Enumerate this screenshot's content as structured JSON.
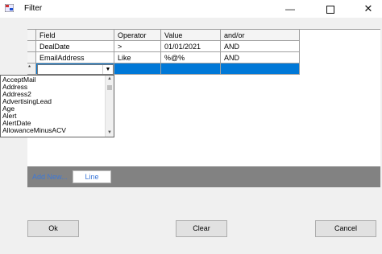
{
  "window": {
    "title": "Filter"
  },
  "grid": {
    "columns": [
      "Field",
      "Operator",
      "Value",
      "and/or"
    ],
    "rows": [
      [
        "DealDate",
        ">",
        "01/01/2021",
        "AND"
      ],
      [
        "EmailAddress",
        "Like",
        "%@%",
        "AND"
      ]
    ],
    "new_row_marker": "*"
  },
  "dropdown": {
    "items": [
      "AcceptMail",
      "Address",
      "Address2",
      "AdvertisingLead",
      "Age",
      "Alert",
      "AlertDate",
      "AllowanceMinusACV"
    ]
  },
  "bottom": {
    "add_new": "Add New...",
    "line_button": "Line"
  },
  "buttons": {
    "ok": "Ok",
    "clear": "Clear",
    "cancel": "Cancel"
  },
  "colors": {
    "selection": "#0078d7",
    "link": "#3c78d8",
    "toolbar": "#828282"
  },
  "icons": {
    "app": "filter-app-icon",
    "minimize": "minimize-icon",
    "maximize": "maximize-icon",
    "close": "close-icon"
  }
}
